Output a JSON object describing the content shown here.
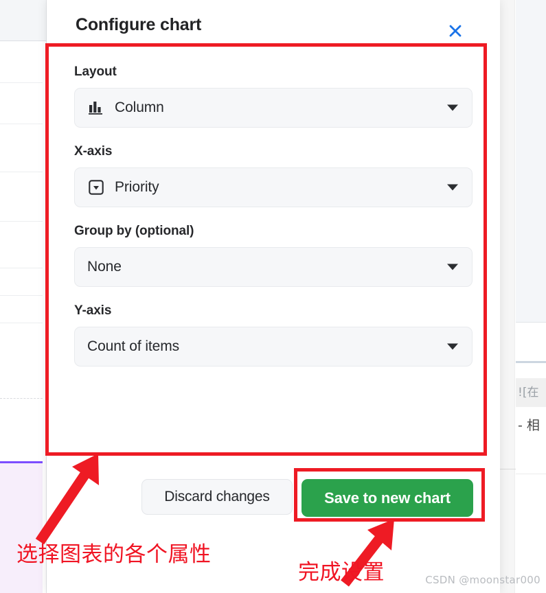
{
  "modal": {
    "title": "Configure chart",
    "close_icon": "close-icon",
    "fields": [
      {
        "label": "Layout",
        "value": "Column",
        "icon": "bar-chart-icon",
        "has_icon": true
      },
      {
        "label": "X-axis",
        "value": "Priority",
        "icon": "select-property-icon",
        "has_icon": true
      },
      {
        "label": "Group by (optional)",
        "value": "None",
        "icon": "",
        "has_icon": false
      },
      {
        "label": "Y-axis",
        "value": "Count of items",
        "icon": "",
        "has_icon": false
      }
    ],
    "footer": {
      "discard_label": "Discard changes",
      "save_label": "Save to new chart"
    }
  },
  "background": {
    "right_code_fragment": "![在",
    "right_text_fragment": "- 相"
  },
  "annotations": {
    "fields_note": "选择图表的各个属性",
    "save_note": "完成设置",
    "box_color": "#ee1b24",
    "arrow_color": "#ee1b24",
    "text_color": "#f01423"
  },
  "watermark": {
    "text": "CSDN @moonstar000"
  },
  "colors": {
    "accent_blue": "#1a73e8",
    "save_green": "#2ba24c",
    "field_bg": "#f6f7f9",
    "selected_row_purple": "#7c4dff",
    "selected_row_bg": "#f7eefb"
  }
}
